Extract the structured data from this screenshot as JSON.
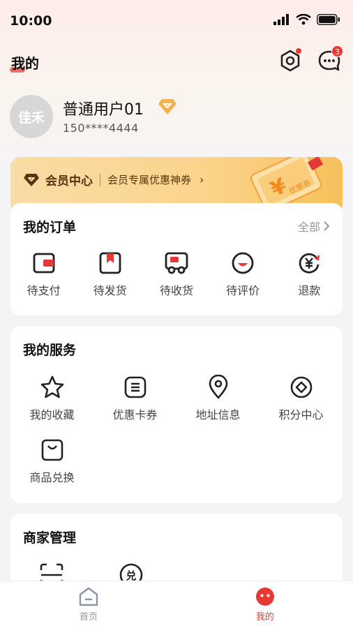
{
  "status_bar": {
    "time": "10:00"
  },
  "header": {
    "title": "我的",
    "message_badge": "3"
  },
  "profile": {
    "avatar_text": "佳禾",
    "username": "普通用户01",
    "phone": "150****4444"
  },
  "member": {
    "title": "会员中心",
    "subtitle": "会员专属优惠神券",
    "arrow": "›",
    "coupon_label": "优惠券",
    "coupon_symbol": "¥"
  },
  "orders": {
    "title": "我的订单",
    "all_label": "全部",
    "items": [
      {
        "label": "待支付",
        "icon": "wallet-icon"
      },
      {
        "label": "待发货",
        "icon": "package-icon"
      },
      {
        "label": "待收货",
        "icon": "truck-icon"
      },
      {
        "label": "待评价",
        "icon": "smile-icon"
      },
      {
        "label": "退款",
        "icon": "refund-icon"
      }
    ]
  },
  "services": {
    "title": "我的服务",
    "items": [
      {
        "label": "我的收藏",
        "icon": "star-icon"
      },
      {
        "label": "优惠卡券",
        "icon": "coupon-icon"
      },
      {
        "label": "地址信息",
        "icon": "location-icon"
      },
      {
        "label": "积分中心",
        "icon": "points-icon"
      },
      {
        "label": "商品兑换",
        "icon": "bag-icon"
      }
    ]
  },
  "merchant": {
    "title": "商家管理",
    "exchange_char": "兑",
    "icons": [
      "scan-icon",
      "redeem-icon"
    ]
  },
  "tabbar": {
    "items": [
      {
        "label": "首页",
        "icon": "home-icon",
        "active": false
      },
      {
        "label": "我的",
        "icon": "mine-icon",
        "active": true
      }
    ]
  },
  "colors": {
    "accent": "#e53935",
    "gold": "#f6c05a",
    "member_text": "#5a3410"
  }
}
